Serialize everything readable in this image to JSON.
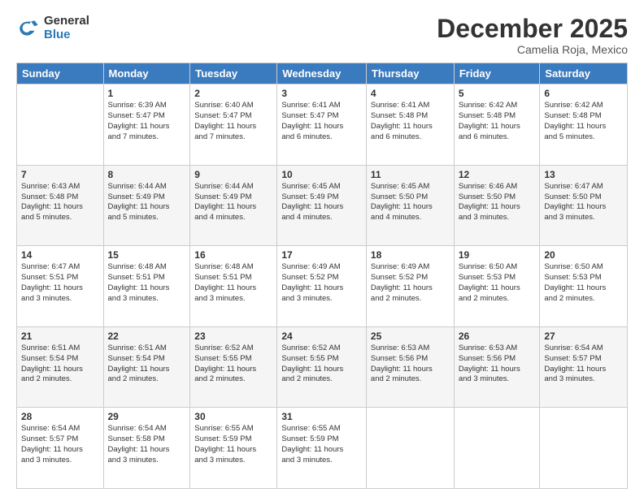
{
  "logo": {
    "general": "General",
    "blue": "Blue"
  },
  "title": "December 2025",
  "subtitle": "Camelia Roja, Mexico",
  "days_of_week": [
    "Sunday",
    "Monday",
    "Tuesday",
    "Wednesday",
    "Thursday",
    "Friday",
    "Saturday"
  ],
  "weeks": [
    [
      {
        "day": "",
        "info": ""
      },
      {
        "day": "1",
        "info": "Sunrise: 6:39 AM\nSunset: 5:47 PM\nDaylight: 11 hours\nand 7 minutes."
      },
      {
        "day": "2",
        "info": "Sunrise: 6:40 AM\nSunset: 5:47 PM\nDaylight: 11 hours\nand 7 minutes."
      },
      {
        "day": "3",
        "info": "Sunrise: 6:41 AM\nSunset: 5:47 PM\nDaylight: 11 hours\nand 6 minutes."
      },
      {
        "day": "4",
        "info": "Sunrise: 6:41 AM\nSunset: 5:48 PM\nDaylight: 11 hours\nand 6 minutes."
      },
      {
        "day": "5",
        "info": "Sunrise: 6:42 AM\nSunset: 5:48 PM\nDaylight: 11 hours\nand 6 minutes."
      },
      {
        "day": "6",
        "info": "Sunrise: 6:42 AM\nSunset: 5:48 PM\nDaylight: 11 hours\nand 5 minutes."
      }
    ],
    [
      {
        "day": "7",
        "info": "Sunrise: 6:43 AM\nSunset: 5:48 PM\nDaylight: 11 hours\nand 5 minutes."
      },
      {
        "day": "8",
        "info": "Sunrise: 6:44 AM\nSunset: 5:49 PM\nDaylight: 11 hours\nand 5 minutes."
      },
      {
        "day": "9",
        "info": "Sunrise: 6:44 AM\nSunset: 5:49 PM\nDaylight: 11 hours\nand 4 minutes."
      },
      {
        "day": "10",
        "info": "Sunrise: 6:45 AM\nSunset: 5:49 PM\nDaylight: 11 hours\nand 4 minutes."
      },
      {
        "day": "11",
        "info": "Sunrise: 6:45 AM\nSunset: 5:50 PM\nDaylight: 11 hours\nand 4 minutes."
      },
      {
        "day": "12",
        "info": "Sunrise: 6:46 AM\nSunset: 5:50 PM\nDaylight: 11 hours\nand 3 minutes."
      },
      {
        "day": "13",
        "info": "Sunrise: 6:47 AM\nSunset: 5:50 PM\nDaylight: 11 hours\nand 3 minutes."
      }
    ],
    [
      {
        "day": "14",
        "info": "Sunrise: 6:47 AM\nSunset: 5:51 PM\nDaylight: 11 hours\nand 3 minutes."
      },
      {
        "day": "15",
        "info": "Sunrise: 6:48 AM\nSunset: 5:51 PM\nDaylight: 11 hours\nand 3 minutes."
      },
      {
        "day": "16",
        "info": "Sunrise: 6:48 AM\nSunset: 5:51 PM\nDaylight: 11 hours\nand 3 minutes."
      },
      {
        "day": "17",
        "info": "Sunrise: 6:49 AM\nSunset: 5:52 PM\nDaylight: 11 hours\nand 3 minutes."
      },
      {
        "day": "18",
        "info": "Sunrise: 6:49 AM\nSunset: 5:52 PM\nDaylight: 11 hours\nand 2 minutes."
      },
      {
        "day": "19",
        "info": "Sunrise: 6:50 AM\nSunset: 5:53 PM\nDaylight: 11 hours\nand 2 minutes."
      },
      {
        "day": "20",
        "info": "Sunrise: 6:50 AM\nSunset: 5:53 PM\nDaylight: 11 hours\nand 2 minutes."
      }
    ],
    [
      {
        "day": "21",
        "info": "Sunrise: 6:51 AM\nSunset: 5:54 PM\nDaylight: 11 hours\nand 2 minutes."
      },
      {
        "day": "22",
        "info": "Sunrise: 6:51 AM\nSunset: 5:54 PM\nDaylight: 11 hours\nand 2 minutes."
      },
      {
        "day": "23",
        "info": "Sunrise: 6:52 AM\nSunset: 5:55 PM\nDaylight: 11 hours\nand 2 minutes."
      },
      {
        "day": "24",
        "info": "Sunrise: 6:52 AM\nSunset: 5:55 PM\nDaylight: 11 hours\nand 2 minutes."
      },
      {
        "day": "25",
        "info": "Sunrise: 6:53 AM\nSunset: 5:56 PM\nDaylight: 11 hours\nand 2 minutes."
      },
      {
        "day": "26",
        "info": "Sunrise: 6:53 AM\nSunset: 5:56 PM\nDaylight: 11 hours\nand 3 minutes."
      },
      {
        "day": "27",
        "info": "Sunrise: 6:54 AM\nSunset: 5:57 PM\nDaylight: 11 hours\nand 3 minutes."
      }
    ],
    [
      {
        "day": "28",
        "info": "Sunrise: 6:54 AM\nSunset: 5:57 PM\nDaylight: 11 hours\nand 3 minutes."
      },
      {
        "day": "29",
        "info": "Sunrise: 6:54 AM\nSunset: 5:58 PM\nDaylight: 11 hours\nand 3 minutes."
      },
      {
        "day": "30",
        "info": "Sunrise: 6:55 AM\nSunset: 5:59 PM\nDaylight: 11 hours\nand 3 minutes."
      },
      {
        "day": "31",
        "info": "Sunrise: 6:55 AM\nSunset: 5:59 PM\nDaylight: 11 hours\nand 3 minutes."
      },
      {
        "day": "",
        "info": ""
      },
      {
        "day": "",
        "info": ""
      },
      {
        "day": "",
        "info": ""
      }
    ]
  ]
}
